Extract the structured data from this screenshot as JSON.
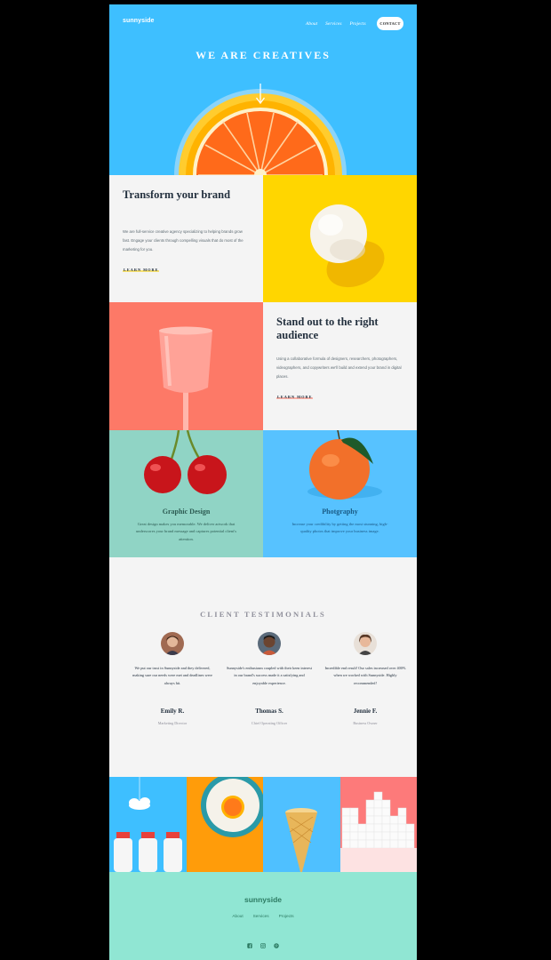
{
  "header": {
    "logo": "sunnyside",
    "nav": [
      "About",
      "Services",
      "Projects"
    ],
    "contact": "CONTACT"
  },
  "hero": {
    "title": "WE ARE CREATIVES"
  },
  "features": [
    {
      "title": "Transform your brand",
      "text": "We are full-service creative agency specializing to helping brands grow fast. Engage your clients through compelling visuals that do most of the marketing for you.",
      "link": "LEARN MORE"
    },
    {
      "title": "Stand out to the right audience",
      "text": "Using a collaborative formula of designers, researchers, photographers, videographers, and copywriters we'll build and extend your brand in digital places.",
      "link": "LEARN MORE"
    }
  ],
  "services": [
    {
      "title": "Graphic Design",
      "text": "Great design makes you memorable. We deliver artwork that underscores your brand message and captures potential client's attention."
    },
    {
      "title": "Photgraphy",
      "text": "Increase your credibility by getting the most stunning, high-quality photos that improve your business image."
    }
  ],
  "testimonials": {
    "title": "CLIENT TESTIMONIALS",
    "items": [
      {
        "quote": "We put our trust in Sunnyside and they delivered, making sure our needs were met and deadlines were always hit.",
        "name": "Emily R.",
        "role": "Marketing Director"
      },
      {
        "quote": "Sunnyside's enthusiasm coupled with their keen interest in our brand's success made it a satisfying and enjoyable experience.",
        "name": "Thomas S.",
        "role": "Chief Operating Officer"
      },
      {
        "quote": "Incredible end result! Our sales increased over 400% when we worked with Sunnyside. Highly recommended!",
        "name": "Jennie F.",
        "role": "Business Owner"
      }
    ]
  },
  "footer": {
    "logo": "sunnyside",
    "nav": [
      "About",
      "Services",
      "Projects"
    ],
    "social": [
      "facebook-icon",
      "instagram-icon",
      "pinterest-icon"
    ]
  },
  "colors": {
    "hero_blue": "#3ebfff",
    "yellow": "#ffd600",
    "coral": "#fd7967",
    "mint": "#90d4c5",
    "footer_mint": "#90e6d3"
  }
}
